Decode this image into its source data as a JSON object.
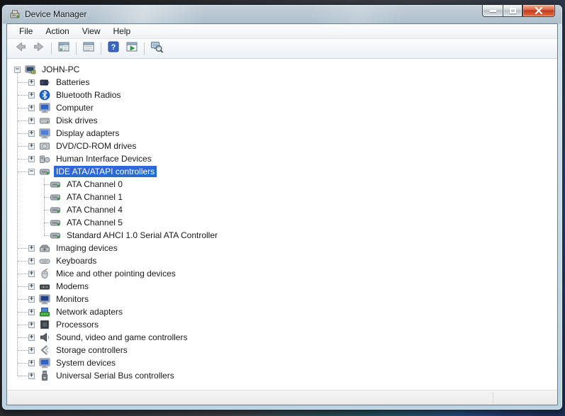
{
  "window": {
    "title": "Device Manager",
    "controls": [
      {
        "name": "minimize"
      },
      {
        "name": "maximize"
      },
      {
        "name": "close"
      }
    ]
  },
  "menubar": {
    "items": [
      "File",
      "Action",
      "View",
      "Help"
    ]
  },
  "toolbar": {
    "items": [
      {
        "type": "button",
        "icon": "back"
      },
      {
        "type": "button",
        "icon": "forward"
      },
      {
        "type": "separator"
      },
      {
        "type": "button",
        "icon": "console-tree"
      },
      {
        "type": "separator"
      },
      {
        "type": "button",
        "icon": "properties"
      },
      {
        "type": "separator"
      },
      {
        "type": "button",
        "icon": "help"
      },
      {
        "type": "button",
        "icon": "action-pane"
      },
      {
        "type": "separator"
      },
      {
        "type": "button",
        "icon": "scan-hardware"
      }
    ]
  },
  "tree": {
    "items": [
      {
        "label": "JOHN-PC",
        "level": 0,
        "expand": "minus",
        "icon": "computer-root",
        "selected": false
      },
      {
        "label": "Batteries",
        "level": 1,
        "expand": "plus",
        "icon": "battery",
        "selected": false
      },
      {
        "label": "Bluetooth Radios",
        "level": 1,
        "expand": "plus",
        "icon": "bluetooth",
        "selected": false
      },
      {
        "label": "Computer",
        "level": 1,
        "expand": "plus",
        "icon": "computer",
        "selected": false
      },
      {
        "label": "Disk drives",
        "level": 1,
        "expand": "plus",
        "icon": "disk",
        "selected": false
      },
      {
        "label": "Display adapters",
        "level": 1,
        "expand": "plus",
        "icon": "display",
        "selected": false
      },
      {
        "label": "DVD/CD-ROM drives",
        "level": 1,
        "expand": "plus",
        "icon": "cdrom",
        "selected": false
      },
      {
        "label": "Human Interface Devices",
        "level": 1,
        "expand": "plus",
        "icon": "hid",
        "selected": false
      },
      {
        "label": "IDE ATA/ATAPI controllers",
        "level": 1,
        "expand": "minus",
        "icon": "ide",
        "selected": true
      },
      {
        "label": "ATA Channel 0",
        "level": 2,
        "expand": "none",
        "icon": "ide",
        "selected": false
      },
      {
        "label": "ATA Channel 1",
        "level": 2,
        "expand": "none",
        "icon": "ide",
        "selected": false
      },
      {
        "label": "ATA Channel 4",
        "level": 2,
        "expand": "none",
        "icon": "ide",
        "selected": false
      },
      {
        "label": "ATA Channel 5",
        "level": 2,
        "expand": "none",
        "icon": "ide",
        "selected": false
      },
      {
        "label": "Standard AHCI 1.0 Serial ATA Controller",
        "level": 2,
        "expand": "none",
        "icon": "ide",
        "selected": false
      },
      {
        "label": "Imaging devices",
        "level": 1,
        "expand": "plus",
        "icon": "imaging",
        "selected": false
      },
      {
        "label": "Keyboards",
        "level": 1,
        "expand": "plus",
        "icon": "keyboard",
        "selected": false
      },
      {
        "label": "Mice and other pointing devices",
        "level": 1,
        "expand": "plus",
        "icon": "mouse",
        "selected": false
      },
      {
        "label": "Modems",
        "level": 1,
        "expand": "plus",
        "icon": "modem",
        "selected": false
      },
      {
        "label": "Monitors",
        "level": 1,
        "expand": "plus",
        "icon": "monitor",
        "selected": false
      },
      {
        "label": "Network adapters",
        "level": 1,
        "expand": "plus",
        "icon": "network",
        "selected": false
      },
      {
        "label": "Processors",
        "level": 1,
        "expand": "plus",
        "icon": "processor",
        "selected": false
      },
      {
        "label": "Sound, video and game controllers",
        "level": 1,
        "expand": "plus",
        "icon": "sound",
        "selected": false
      },
      {
        "label": "Storage controllers",
        "level": 1,
        "expand": "plus",
        "icon": "storage",
        "selected": false
      },
      {
        "label": "System devices",
        "level": 1,
        "expand": "plus",
        "icon": "system",
        "selected": false
      },
      {
        "label": "Universal Serial Bus controllers",
        "level": 1,
        "expand": "plus",
        "icon": "usb",
        "selected": false
      }
    ]
  },
  "statusbar": {
    "left_text": "",
    "right_text": ""
  },
  "colors": {
    "selection_blue": "#2a6ad4",
    "titlebar_steel": "#aec0cd",
    "close_button_red": "#c23a20",
    "help_icon_blue": "#3a66c4"
  }
}
